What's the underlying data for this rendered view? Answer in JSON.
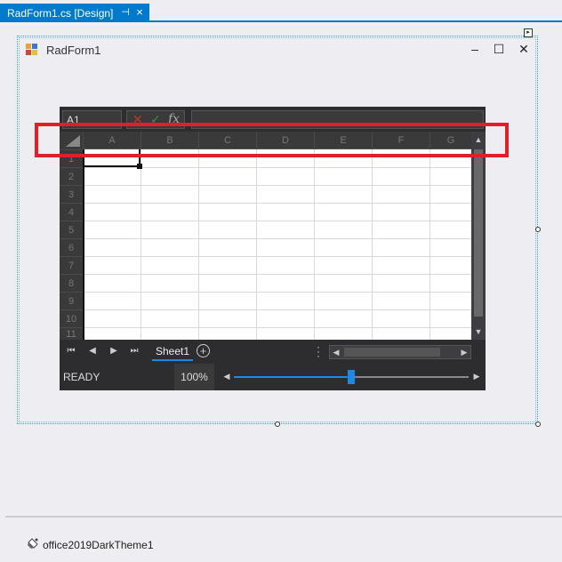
{
  "document_tab": {
    "label": "RadForm1.cs [Design]",
    "pin_icon": "pin-icon",
    "close_icon": "close-icon"
  },
  "form": {
    "title": "RadForm1",
    "minimize": "–",
    "maximize": "☐",
    "close": "✕"
  },
  "spreadsheet": {
    "name_box": "A1",
    "cancel_glyph": "✕",
    "confirm_glyph": "✓",
    "fx_label": "fx",
    "columns": [
      "A",
      "B",
      "C",
      "D",
      "E",
      "F",
      "G"
    ],
    "rows": [
      "1",
      "2",
      "3",
      "4",
      "5",
      "6",
      "7",
      "8",
      "9",
      "10",
      "11"
    ],
    "sheet_tab": "Sheet1",
    "add_sheet": "+",
    "status": "READY",
    "zoom": "100%",
    "zoom_level_fraction": 0.5
  },
  "tray": {
    "component": "office2019DarkTheme1"
  },
  "colors": {
    "accent": "#007acc",
    "highlight": "#e21f26",
    "sheet_dark": "#2d2d30",
    "cancel": "#c0392b",
    "confirm": "#2e9a3c"
  }
}
